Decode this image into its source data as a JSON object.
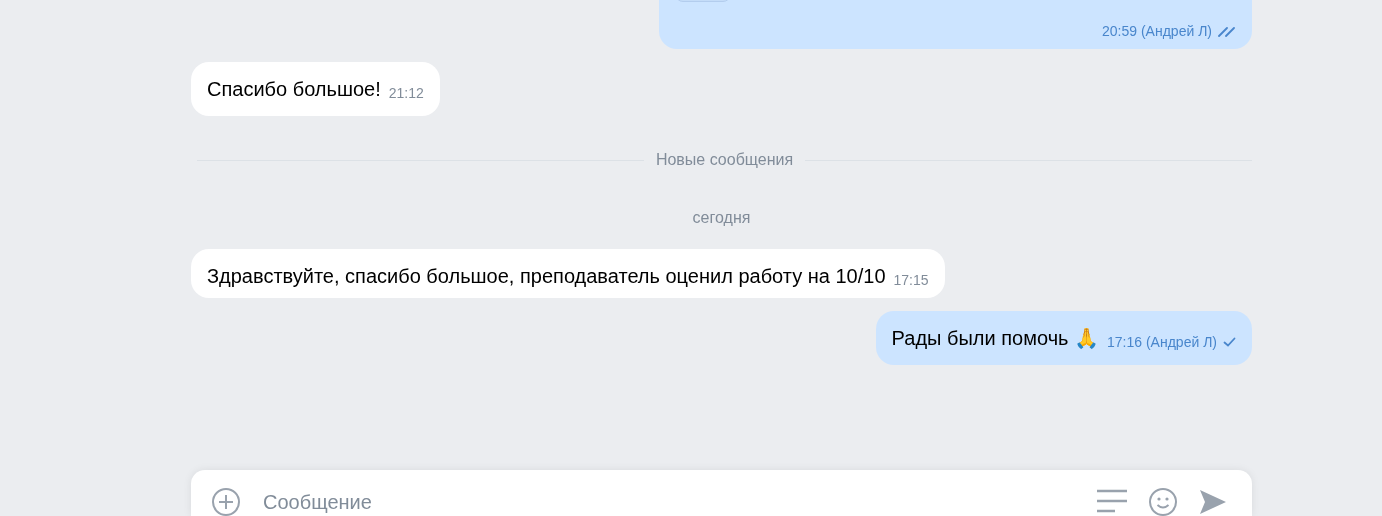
{
  "messages": [
    {
      "kind": "outgoing",
      "attachment": true,
      "time": "20:59 (Андрей Л)",
      "read": true
    },
    {
      "kind": "incoming",
      "text": "Спасибо большое!",
      "time": "21:12"
    },
    {
      "kind": "divider",
      "text": "Новые сообщения"
    },
    {
      "kind": "date",
      "text": "сегодня"
    },
    {
      "kind": "incoming",
      "text": "Здравствуйте, спасибо большое, преподаватель оценил работу на 10/10",
      "time": "17:15"
    },
    {
      "kind": "outgoing",
      "text": "Рады были помочь 🙏",
      "time": "17:16 (Андрей Л)",
      "read": false
    }
  ],
  "composer": {
    "placeholder": "Сообщение"
  }
}
